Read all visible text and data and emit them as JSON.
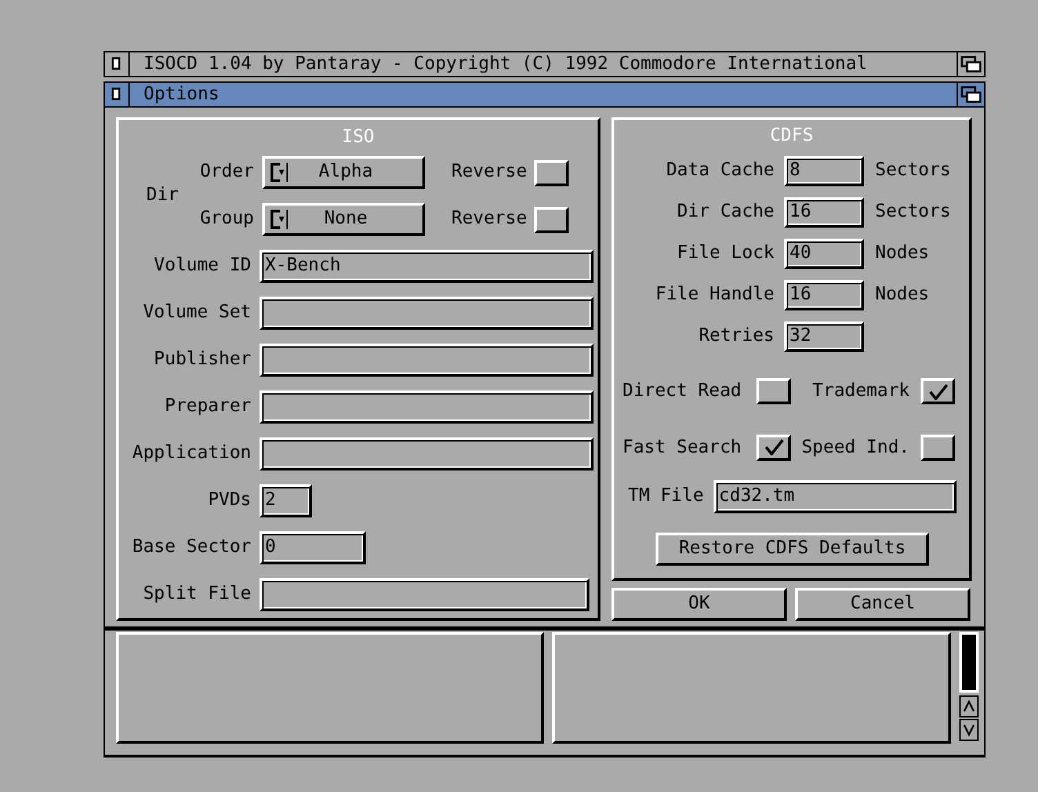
{
  "windows": [
    {
      "title": "ISOCD 1.04 by Pantaray - Copyright (C) 1992 Commodore International",
      "active": false
    },
    {
      "title": "Options",
      "active": true
    }
  ],
  "iso": {
    "title": "ISO",
    "dir_label": "Dir",
    "cycles": [
      {
        "label": "Order",
        "value": "Alpha",
        "reverse_label": "Reverse",
        "reverse_checked": false
      },
      {
        "label": "Group",
        "value": "None",
        "reverse_label": "Reverse",
        "reverse_checked": false
      }
    ],
    "fields": [
      {
        "label": "Volume ID",
        "value": "X-Bench"
      },
      {
        "label": "Volume Set"
      },
      {
        "label": "Publisher"
      },
      {
        "label": "Preparer"
      },
      {
        "label": "Application"
      },
      {
        "label": "PVDs",
        "value": "2"
      },
      {
        "label": "Base Sector",
        "value": "0"
      },
      {
        "label": "Split File"
      }
    ]
  },
  "cdfs": {
    "title": "CDFS",
    "settings": [
      {
        "label": "Data Cache",
        "value": "8",
        "unit": "Sectors"
      },
      {
        "label": "Dir Cache",
        "value": "16",
        "unit": "Sectors"
      },
      {
        "label": "File Lock",
        "value": "40",
        "unit": "Nodes"
      },
      {
        "label": "File Handle",
        "value": "16",
        "unit": "Nodes"
      },
      {
        "label": "Retries",
        "value": "32"
      }
    ],
    "toggles": [
      {
        "label": "Direct Read",
        "checked": false
      },
      {
        "label": "Trademark",
        "checked": true
      },
      {
        "label": "Fast Search",
        "checked": true
      },
      {
        "label": "Speed Ind.",
        "checked": false
      }
    ],
    "tm_file": {
      "label": "TM File",
      "value": "cd32.tm"
    },
    "restore_button": "Restore CDFS Defaults"
  },
  "buttons": [
    "OK",
    "Cancel"
  ]
}
